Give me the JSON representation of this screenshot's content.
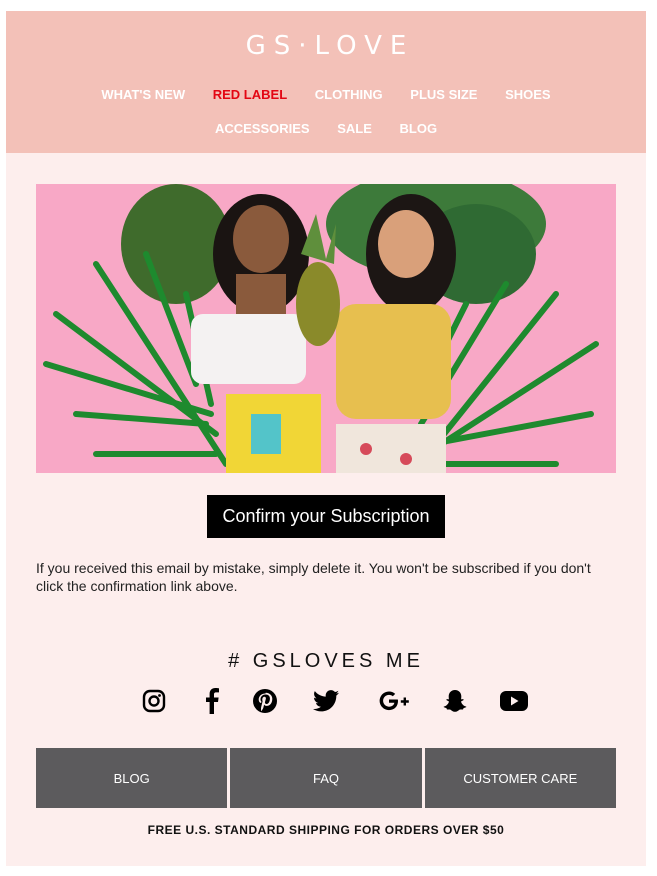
{
  "brand": {
    "logo_text": "GS·LOVE"
  },
  "colors": {
    "header_bg": "#f3c1b8",
    "body_bg": "#fdeeed",
    "accent_red": "#e30613",
    "footer_button_bg": "#5c5b5d",
    "hero_bg": "#f8a8c6"
  },
  "nav": {
    "row1": [
      {
        "label": "WHAT'S NEW"
      },
      {
        "label": "RED LABEL",
        "highlight": true
      },
      {
        "label": "CLOTHING"
      },
      {
        "label": "PLUS SIZE"
      },
      {
        "label": "SHOES"
      }
    ],
    "row2": [
      {
        "label": "ACCESSORIES"
      },
      {
        "label": "SALE"
      },
      {
        "label": "BLOG"
      }
    ]
  },
  "hero": {
    "description": "Two smiling women holding a pineapple in front of tropical leaves on a pink background"
  },
  "cta": {
    "label": "Confirm your Subscription"
  },
  "notice": {
    "text": "If you received this email by mistake, simply delete it. You won't be subscribed if you don't click the confirmation link above."
  },
  "social": {
    "heading": "# GSLOVES ME",
    "icons": [
      "instagram-icon",
      "facebook-icon",
      "pinterest-icon",
      "twitter-icon",
      "google-plus-icon",
      "snapchat-icon",
      "youtube-icon"
    ]
  },
  "footer": {
    "links": [
      {
        "label": "BLOG"
      },
      {
        "label": "FAQ"
      },
      {
        "label": "CUSTOMER CARE"
      }
    ],
    "shipping": "FREE U.S. STANDARD SHIPPING FOR ORDERS OVER $50"
  }
}
